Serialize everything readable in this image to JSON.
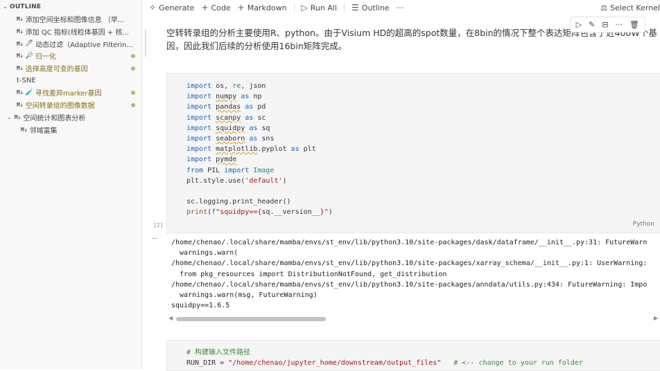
{
  "outline": {
    "header": "OUTLINE",
    "items": [
      {
        "tag": "M↓",
        "label": "添加空间坐标和图像信息 （早...",
        "indent": 1,
        "modified": false,
        "dot": false,
        "emoji": ""
      },
      {
        "tag": "M↓",
        "label": "添加 QC 指标(线粒体基因 + 核...",
        "indent": 1,
        "modified": false,
        "dot": false,
        "emoji": ""
      },
      {
        "tag": "M↓",
        "label": "动态过滤（Adaptive Filterin...",
        "indent": 1,
        "modified": false,
        "dot": false,
        "emoji": "🖊"
      },
      {
        "tag": "M↓",
        "label": "归一化",
        "indent": 1,
        "modified": true,
        "dot": true,
        "emoji": "🔎"
      },
      {
        "tag": "M↓",
        "label": "选择高度可变的基因",
        "indent": 1,
        "modified": true,
        "dot": true,
        "emoji": ""
      },
      {
        "tag": "",
        "label": "t-SNE",
        "indent": 1,
        "modified": false,
        "dot": false,
        "emoji": ""
      },
      {
        "tag": "M↓",
        "label": "寻找差异marker基因",
        "indent": 1,
        "modified": true,
        "dot": true,
        "emoji": "🧪"
      },
      {
        "tag": "M↓",
        "label": "空间转录组的图像数据",
        "indent": 1,
        "modified": true,
        "dot": true,
        "emoji": ""
      },
      {
        "tag": "M↓",
        "label": "空间统计和图表分析",
        "indent": 0,
        "modified": false,
        "dot": false,
        "emoji": "",
        "expanded": true
      },
      {
        "tag": "M↓",
        "label": "邻域富集",
        "indent": 2,
        "modified": false,
        "dot": false,
        "emoji": ""
      }
    ]
  },
  "toolbar": {
    "generate": "Generate",
    "code": "Code",
    "markdown": "Markdown",
    "run_all": "Run All",
    "outline": "Outline",
    "more": "···",
    "select_kernel": "Select Kernel"
  },
  "markdown_cell": {
    "text": "空转转录组的分析主要使用R、python。由于Visium HD的超高的spot数量，在8bin的情况下整个表达矩阵包含了近400W个基因，因此我们后续的分析使用16bin矩阵完成。"
  },
  "code_cell": {
    "exec_count": "[2]",
    "language": "Python"
  },
  "output": {
    "lines": [
      "/home/chenao/.local/share/mamba/envs/st_env/lib/python3.10/site-packages/dask/dataframe/__init__.py:31: FutureWarn",
      "  warnings.warn(",
      "/home/chenao/.local/share/mamba/envs/st_env/lib/python3.10/site-packages/xarray_schema/__init__.py:1: UserWarning:",
      "  from pkg_resources import DistributionNotFound, get_distribution",
      "/home/chenao/.local/share/mamba/envs/st_env/lib/python3.10/site-packages/anndata/utils.py:434: FutureWarning: Impo",
      "  warnings.warn(msg, FutureWarning)",
      "squidpy==1.6.5"
    ]
  },
  "code_cell2": {
    "comment": "# 构建输入文件路径",
    "run_dir_line_var": "RUN_DIR",
    "run_dir_value": "\"/home/chenao/jupyter_home/downstream/output_files\"",
    "run_dir_comment": "# <-- change to your run folder"
  }
}
